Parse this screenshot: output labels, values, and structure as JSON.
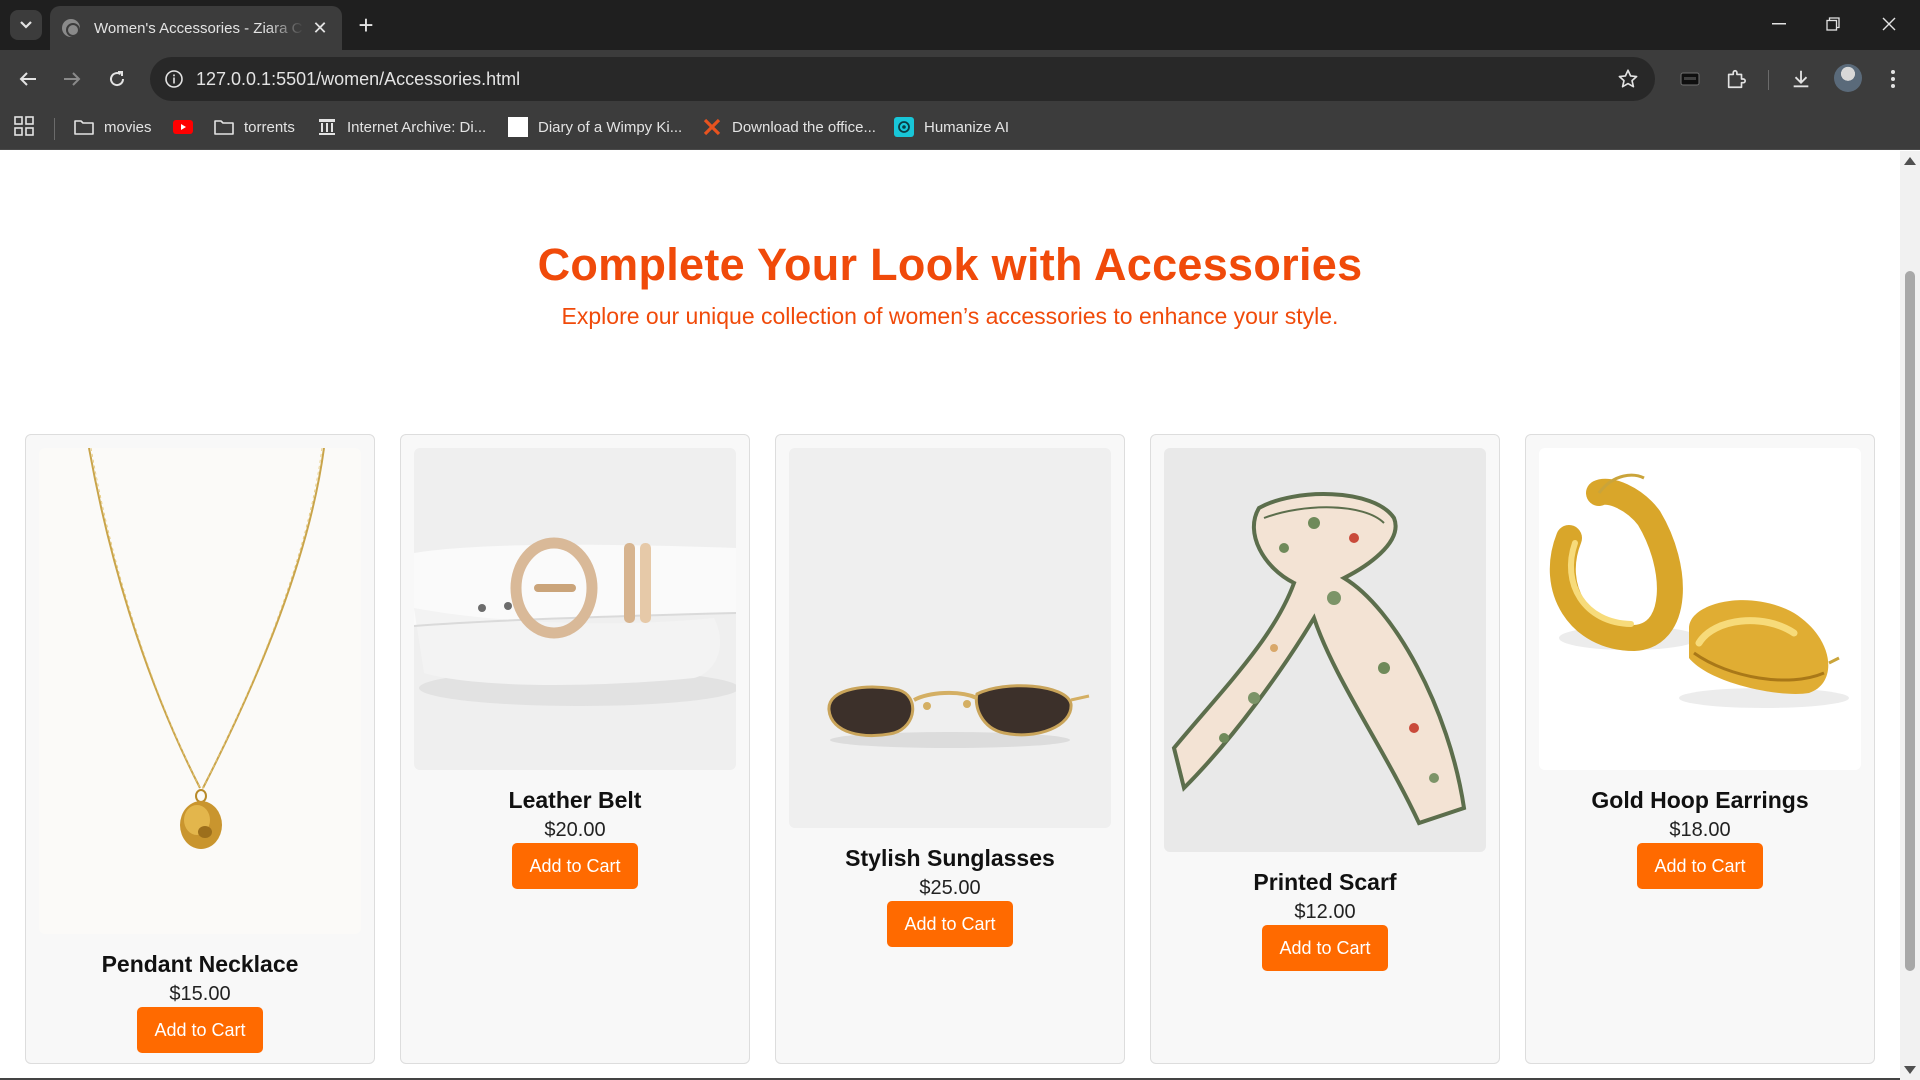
{
  "browser": {
    "tab_title": "Women's Accessories - Ziara Clothing",
    "new_tab_symbol": "+",
    "close_symbol": "✕",
    "url": "127.0.0.1:5501/women/Accessories.html",
    "window_controls": {
      "minimize": "—",
      "restore": "❐",
      "close": "✕"
    }
  },
  "bookmarks": [
    {
      "label": "movies",
      "icon": "folder-icon"
    },
    {
      "label": "",
      "icon": "youtube-icon"
    },
    {
      "label": "torrents",
      "icon": "folder-icon"
    },
    {
      "label": "Internet Archive: Di...",
      "icon": "archive-icon"
    },
    {
      "label": "Diary of a Wimpy Ki...",
      "icon": "blank-page-icon"
    },
    {
      "label": "Download the office...",
      "icon": "x-logo-icon"
    },
    {
      "label": "Humanize AI",
      "icon": "humanize-icon"
    }
  ],
  "hero": {
    "title": "Complete Your Look with Accessories",
    "subtitle": "Explore our unique collection of women’s accessories to enhance your style."
  },
  "products": [
    {
      "name": "Pendant Necklace",
      "price": "$15.00",
      "button": "Add to Cart",
      "image": "necklace-image"
    },
    {
      "name": "Leather Belt",
      "price": "$20.00",
      "button": "Add to Cart",
      "image": "belt-image"
    },
    {
      "name": "Stylish Sunglasses",
      "price": "$25.00",
      "button": "Add to Cart",
      "image": "sunglasses-image"
    },
    {
      "name": "Printed Scarf",
      "price": "$12.00",
      "button": "Add to Cart",
      "image": "scarf-image"
    },
    {
      "name": "Gold Hoop Earrings",
      "price": "$18.00",
      "button": "Add to Cart",
      "image": "earrings-image"
    }
  ],
  "colors": {
    "accent": "#f04a0a",
    "button": "#ff6a00",
    "chrome_dark": "#1f1f1f",
    "chrome_toolbar": "#3c3c3c"
  }
}
